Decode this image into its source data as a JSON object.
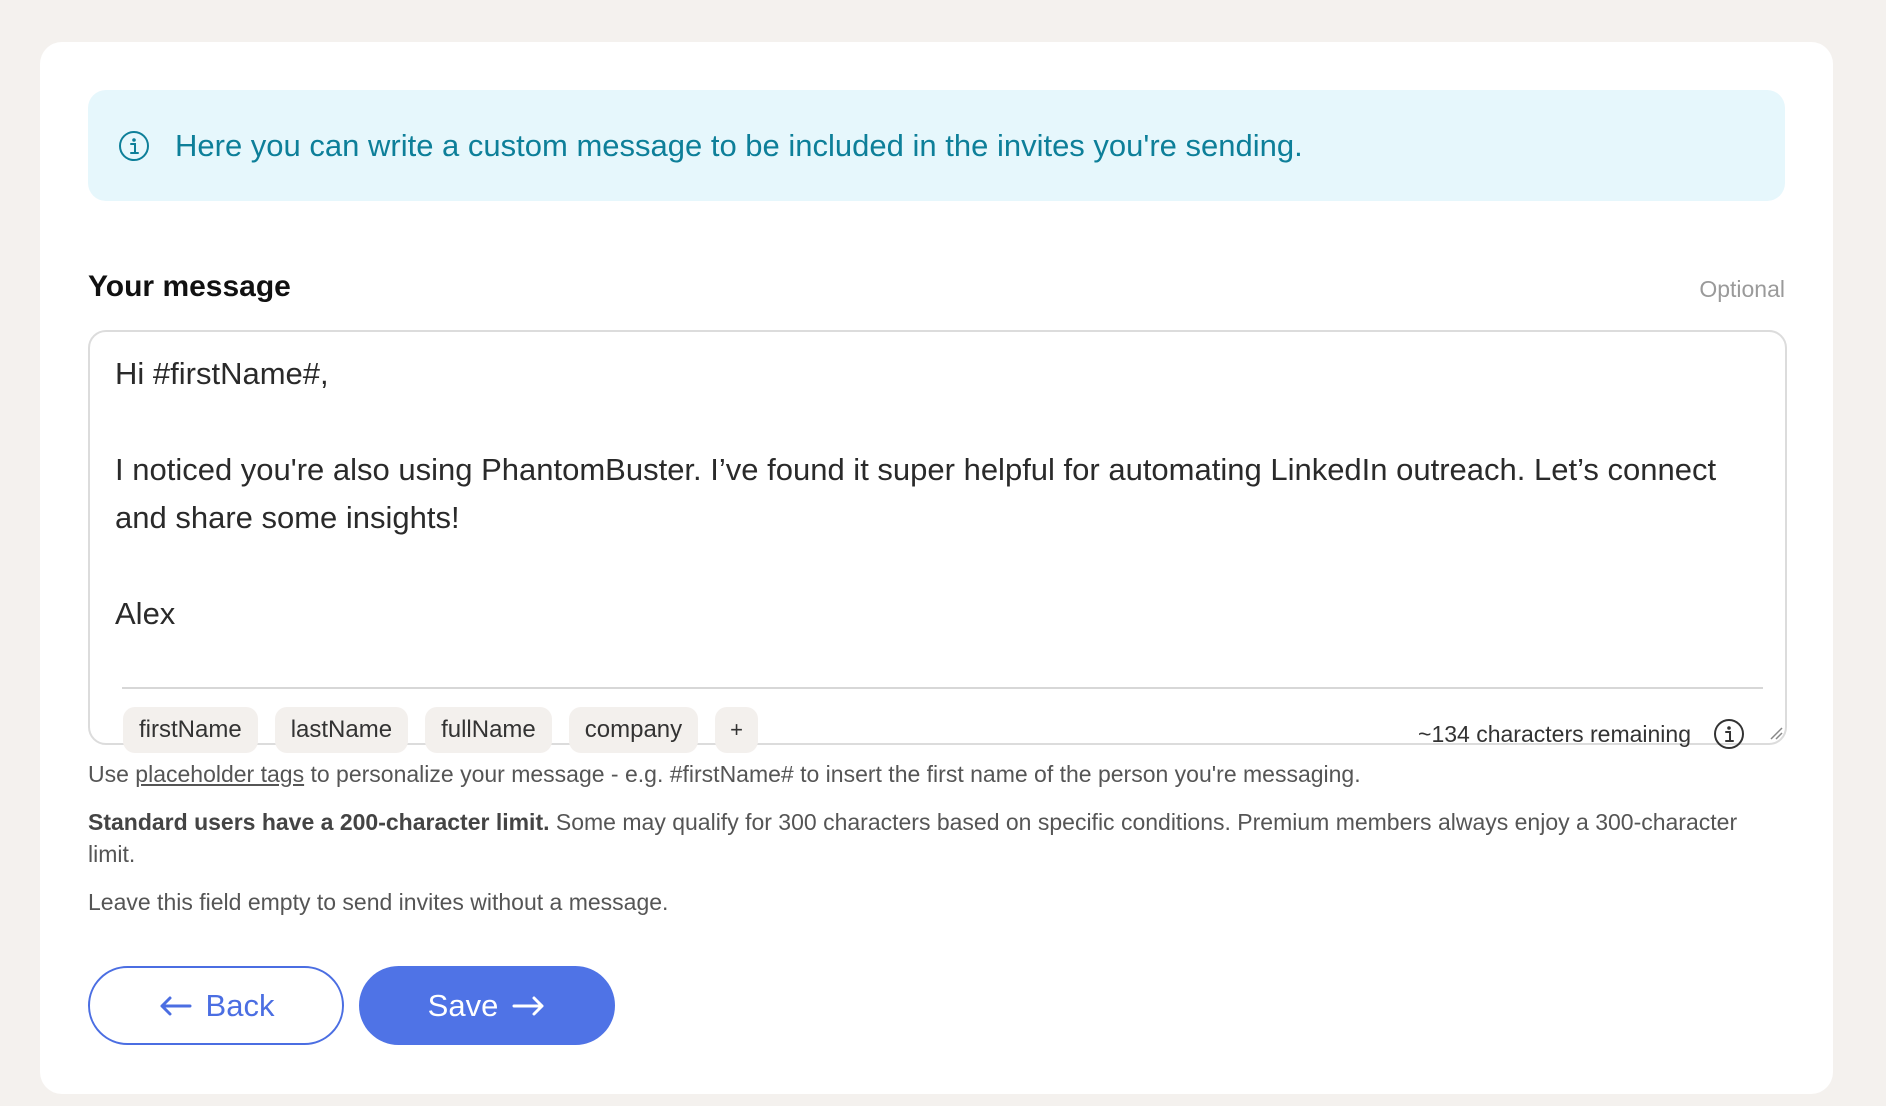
{
  "banner": {
    "text": "Here you can write a custom message to be included in the invites you're sending.",
    "icon": "info-circle-icon",
    "bg_color": "#e6f7fc",
    "text_color": "#0d7f99"
  },
  "message_section": {
    "title": "Your message",
    "optional_label": "Optional",
    "message_value": "Hi #firstName#,\n\nI noticed you're also using PhantomBuster. I’ve found it super helpful for automating LinkedIn outreach. Let’s connect and share some insights!\n\nAlex",
    "tags": [
      "firstName",
      "lastName",
      "fullName",
      "company",
      "+"
    ],
    "char_remaining": "~134 characters remaining",
    "char_info_icon": "info-circle-icon"
  },
  "help": {
    "line1_prefix": "Use ",
    "line1_link": "placeholder tags",
    "line1_suffix": " to personalize your message - e.g. #firstName# to insert the first name of the person you're messaging.",
    "line2_bold": "Standard users have a 200-character limit.",
    "line2_rest": " Some may qualify for 300 characters based on specific conditions. Premium members always enjoy a 300-character limit.",
    "line3": "Leave this field empty to send invites without a message."
  },
  "actions": {
    "back_label": "Back",
    "save_label": "Save",
    "accent_color": "#4f73e6"
  }
}
